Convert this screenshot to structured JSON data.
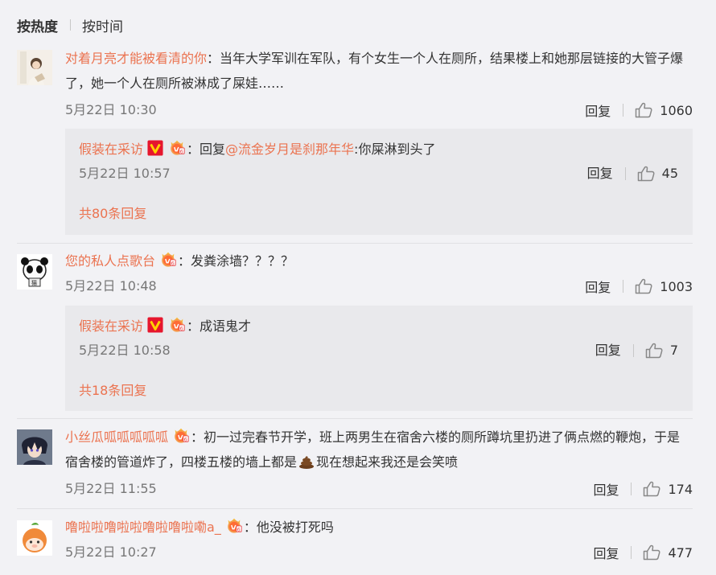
{
  "tabs": {
    "active": "按热度",
    "other": "按时间"
  },
  "colors": {
    "username": "#eb7350",
    "background": "#f2f2f5",
    "reply_bg": "#e9e9ec"
  },
  "comments": [
    {
      "user": "对着月亮才能被看清的你",
      "text": "：当年大学军训在军队，有个女生一个人在厕所，结果楼上和她那层链接的大管子爆了，她一个人在厕所被淋成了屎娃……",
      "time": "5月22日 10:30",
      "reply_label": "回复",
      "likes": "1060",
      "reply": {
        "user": "假装在采访",
        "prefix": "：回复",
        "mention": "@流金岁月是刹那年华",
        "text": ":你屎淋到头了",
        "time": "5月22日 10:57",
        "reply_label": "回复",
        "likes": "45"
      },
      "more": "共80条回复"
    },
    {
      "user": "您的私人点歌台",
      "text": "：发粪涂墙？？？？",
      "time": "5月22日 10:48",
      "reply_label": "回复",
      "likes": "1003",
      "reply": {
        "user": "假装在采访",
        "text": "：成语鬼才",
        "time": "5月22日 10:58",
        "reply_label": "回复",
        "likes": "7"
      },
      "more": "共18条回复"
    },
    {
      "user": "小丝瓜呱呱呱呱呱",
      "text_a": "：初一过完春节开学，班上两男生在宿舍六楼的厕所蹲坑里扔进了俩点燃的鞭炮，于是宿舍楼的管道炸了，四楼五楼的墙上都是",
      "text_b": "现在想起来我还是会笑喷",
      "time": "5月22日 11:55",
      "reply_label": "回复",
      "likes": "174"
    },
    {
      "user": "噜啦啦噜啦啦噜啦噜啦嘞a_",
      "text": "：他没被打死吗",
      "time": "5月22日 10:27",
      "reply_label": "回复",
      "likes": "477"
    }
  ]
}
